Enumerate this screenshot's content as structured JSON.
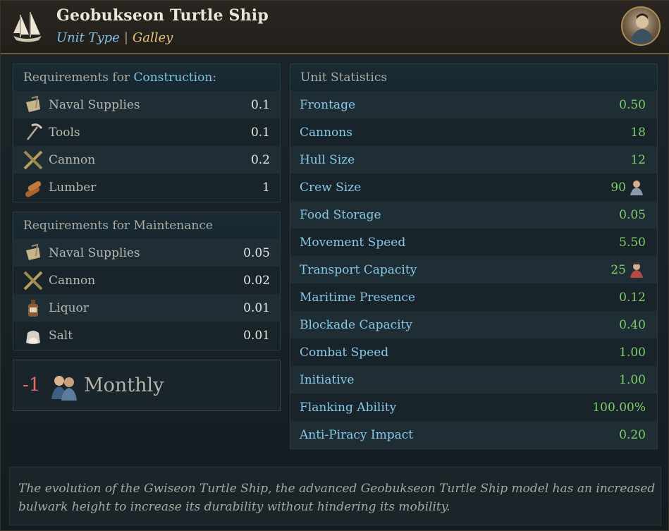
{
  "header": {
    "title": "Geobukseon Turtle Ship",
    "unit_type_label": "Unit Type",
    "separator": "|",
    "unit_class": "Galley",
    "ship_icon": "sailing-ship-icon",
    "portrait_icon": "advisor-portrait"
  },
  "construction": {
    "head_prefix": "Requirements for ",
    "head_highlight": "Construction",
    "head_suffix": ":",
    "items": [
      {
        "label": "Naval Supplies",
        "value": "0.1",
        "icon": "naval-supplies-icon"
      },
      {
        "label": "Tools",
        "value": "0.1",
        "icon": "tools-icon"
      },
      {
        "label": "Cannon",
        "value": "0.2",
        "icon": "cannon-icon"
      },
      {
        "label": "Lumber",
        "value": "1",
        "icon": "lumber-icon"
      }
    ]
  },
  "maintenance": {
    "head": "Requirements for Maintenance",
    "items": [
      {
        "label": "Naval Supplies",
        "value": "0.05",
        "icon": "naval-supplies-icon"
      },
      {
        "label": "Cannon",
        "value": "0.02",
        "icon": "cannon-icon"
      },
      {
        "label": "Liquor",
        "value": "0.01",
        "icon": "liquor-icon"
      },
      {
        "label": "Salt",
        "value": "0.01",
        "icon": "salt-icon"
      }
    ]
  },
  "monthly": {
    "value": "-1",
    "label": "Monthly",
    "icon": "population-icon"
  },
  "stats": {
    "head": "Unit Statistics",
    "items": [
      {
        "label": "Frontage",
        "value": "0.50"
      },
      {
        "label": "Cannons",
        "value": "18"
      },
      {
        "label": "Hull Size",
        "value": "12"
      },
      {
        "label": "Crew Size",
        "value": "90",
        "icon": "crew-icon"
      },
      {
        "label": "Food Storage",
        "value": "0.05"
      },
      {
        "label": "Movement Speed",
        "value": "5.50"
      },
      {
        "label": "Transport Capacity",
        "value": "25",
        "icon": "troops-icon"
      },
      {
        "label": "Maritime Presence",
        "value": "0.12"
      },
      {
        "label": "Blockade Capacity",
        "value": "0.40"
      },
      {
        "label": "Combat Speed",
        "value": "1.00"
      },
      {
        "label": "Initiative",
        "value": "1.00"
      },
      {
        "label": "Flanking Ability",
        "value": "100.00%"
      },
      {
        "label": "Anti-Piracy Impact",
        "value": "0.20"
      }
    ]
  },
  "description": {
    "line1": "The evolution of the Gwiseon Turtle Ship, the advanced Geobukseon Turtle Ship model has an increased",
    "line2": "bulwark height to increase its durability without hindering its mobility."
  },
  "colors": {
    "accent_blue": "#7fc3e6",
    "gold": "#e8c67a",
    "green_value": "#7ed06b",
    "red_value": "#e26a6a"
  }
}
